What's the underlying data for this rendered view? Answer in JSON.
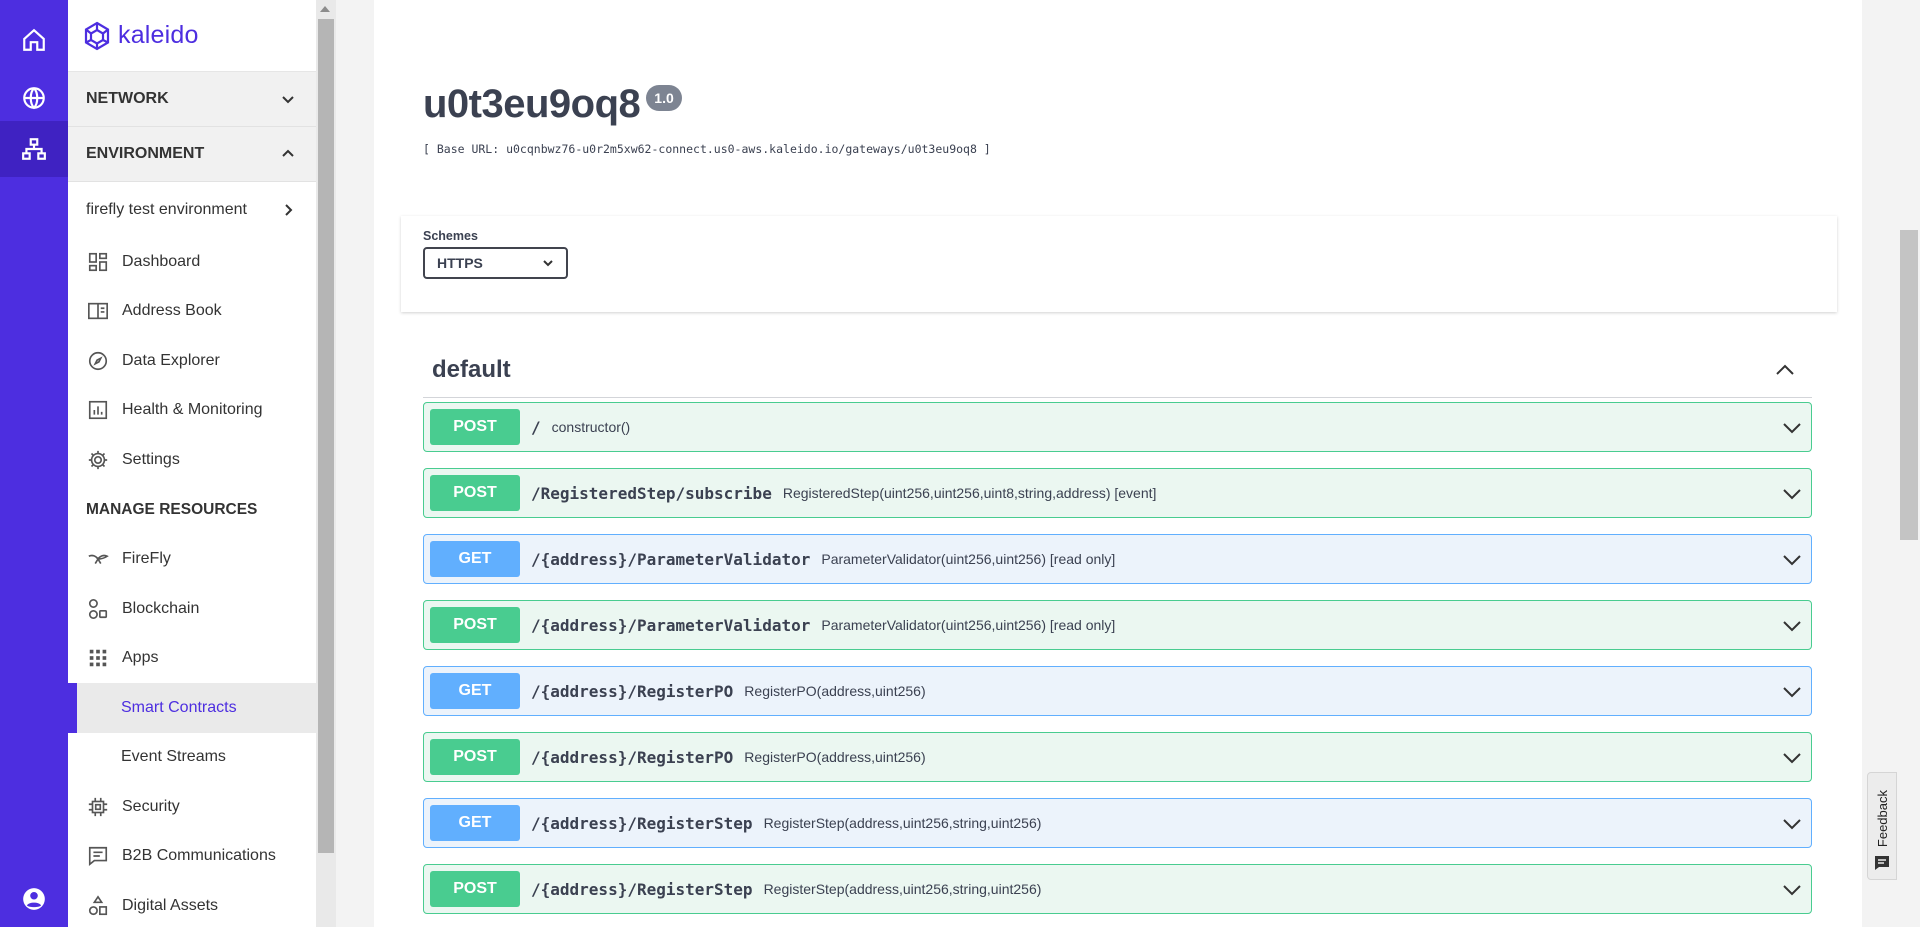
{
  "rail": {
    "icons": [
      "home-icon",
      "globe-icon",
      "network-icon",
      "account-icon"
    ]
  },
  "sidebar": {
    "logo_text": "kaleido",
    "network_label": "NETWORK",
    "environment_label": "ENVIRONMENT",
    "environment_name": "firefly test environment",
    "env_items": [
      {
        "label": "Dashboard",
        "icon": "dashboard-icon"
      },
      {
        "label": "Address Book",
        "icon": "address-book-icon"
      },
      {
        "label": "Data Explorer",
        "icon": "compass-icon"
      },
      {
        "label": "Health & Monitoring",
        "icon": "bar-chart-icon"
      },
      {
        "label": "Settings",
        "icon": "gear-icon"
      }
    ],
    "manage_label": "MANAGE RESOURCES",
    "resource_items": [
      {
        "label": "FireFly",
        "icon": "firefly-icon"
      },
      {
        "label": "Blockchain",
        "icon": "blockchain-icon"
      },
      {
        "label": "Apps",
        "icon": "apps-grid-icon"
      },
      {
        "label": "Smart Contracts"
      },
      {
        "label": "Event Streams"
      },
      {
        "label": "Security",
        "icon": "chip-icon"
      },
      {
        "label": "B2B Communications",
        "icon": "message-icon"
      },
      {
        "label": "Digital Assets",
        "icon": "assets-icon"
      }
    ]
  },
  "api": {
    "title": "u0t3eu9oq8",
    "version": "1.0",
    "base_url": "[ Base URL: u0cqnbwz76-u0r2m5xw62-connect.us0-aws.kaleido.io/gateways/u0t3eu9oq8 ]",
    "schemes_label": "Schemes",
    "scheme_selected": "HTTPS",
    "tag": "default"
  },
  "operations": [
    {
      "method": "POST",
      "path": "/",
      "summary": "constructor()"
    },
    {
      "method": "POST",
      "path": "/RegisteredStep/subscribe",
      "summary": "RegisteredStep(uint256,uint256,uint8,string,address) [event]"
    },
    {
      "method": "GET",
      "path": "/{address}/ParameterValidator",
      "summary": "ParameterValidator(uint256,uint256) [read only]"
    },
    {
      "method": "POST",
      "path": "/{address}/ParameterValidator",
      "summary": "ParameterValidator(uint256,uint256) [read only]"
    },
    {
      "method": "GET",
      "path": "/{address}/RegisterPO",
      "summary": "RegisterPO(address,uint256)"
    },
    {
      "method": "POST",
      "path": "/{address}/RegisterPO",
      "summary": "RegisterPO(address,uint256)"
    },
    {
      "method": "GET",
      "path": "/{address}/RegisterStep",
      "summary": "RegisterStep(address,uint256,string,uint256)"
    },
    {
      "method": "POST",
      "path": "/{address}/RegisterStep",
      "summary": "RegisterStep(address,uint256,string,uint256)"
    }
  ],
  "feedback_label": "Feedback",
  "colors": {
    "brand": "#4d2ee0",
    "post": "#49cc90",
    "get": "#61affe"
  }
}
